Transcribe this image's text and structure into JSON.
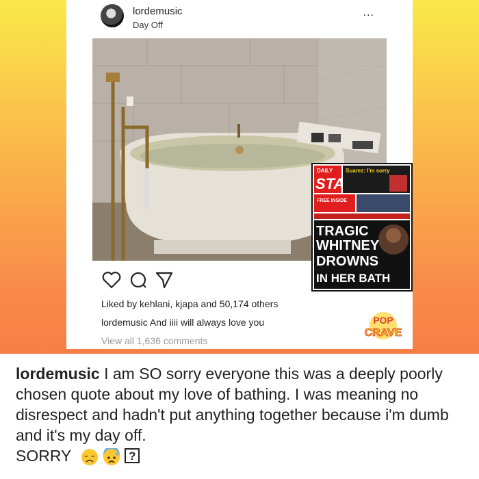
{
  "post": {
    "username": "lordemusic",
    "location": "Day Off",
    "more_icon": "...",
    "likes_text": "Liked by kehlani, kjapa and 50,174 others",
    "caption_user": "lordemusic",
    "caption_text": "And iiii will always love you",
    "view_comments": "View all 1,636 comments"
  },
  "newspaper": {
    "masthead_top": "DAILY",
    "masthead": "STAR",
    "promo": "Suarez: I'm sorry",
    "free_inside": "FREE INSIDE",
    "headline_lines": [
      "TRAGIC",
      "WHITNEY",
      "DROWNS",
      "IN HER BATH"
    ]
  },
  "watermark": {
    "top": "POP",
    "bottom": "CRAVE"
  },
  "note": {
    "username": "lordemusic",
    "text": "I am SO sorry everyone this was a deeply poorly chosen quote about my love of bathing. I was meaning no disrespect and hadn't put anything together because i'm dumb and it's my day off.",
    "final": "SORRY",
    "emojis": [
      "disappointed-face",
      "anxious-sweat-face",
      "question-box"
    ],
    "question_glyph": "?"
  }
}
